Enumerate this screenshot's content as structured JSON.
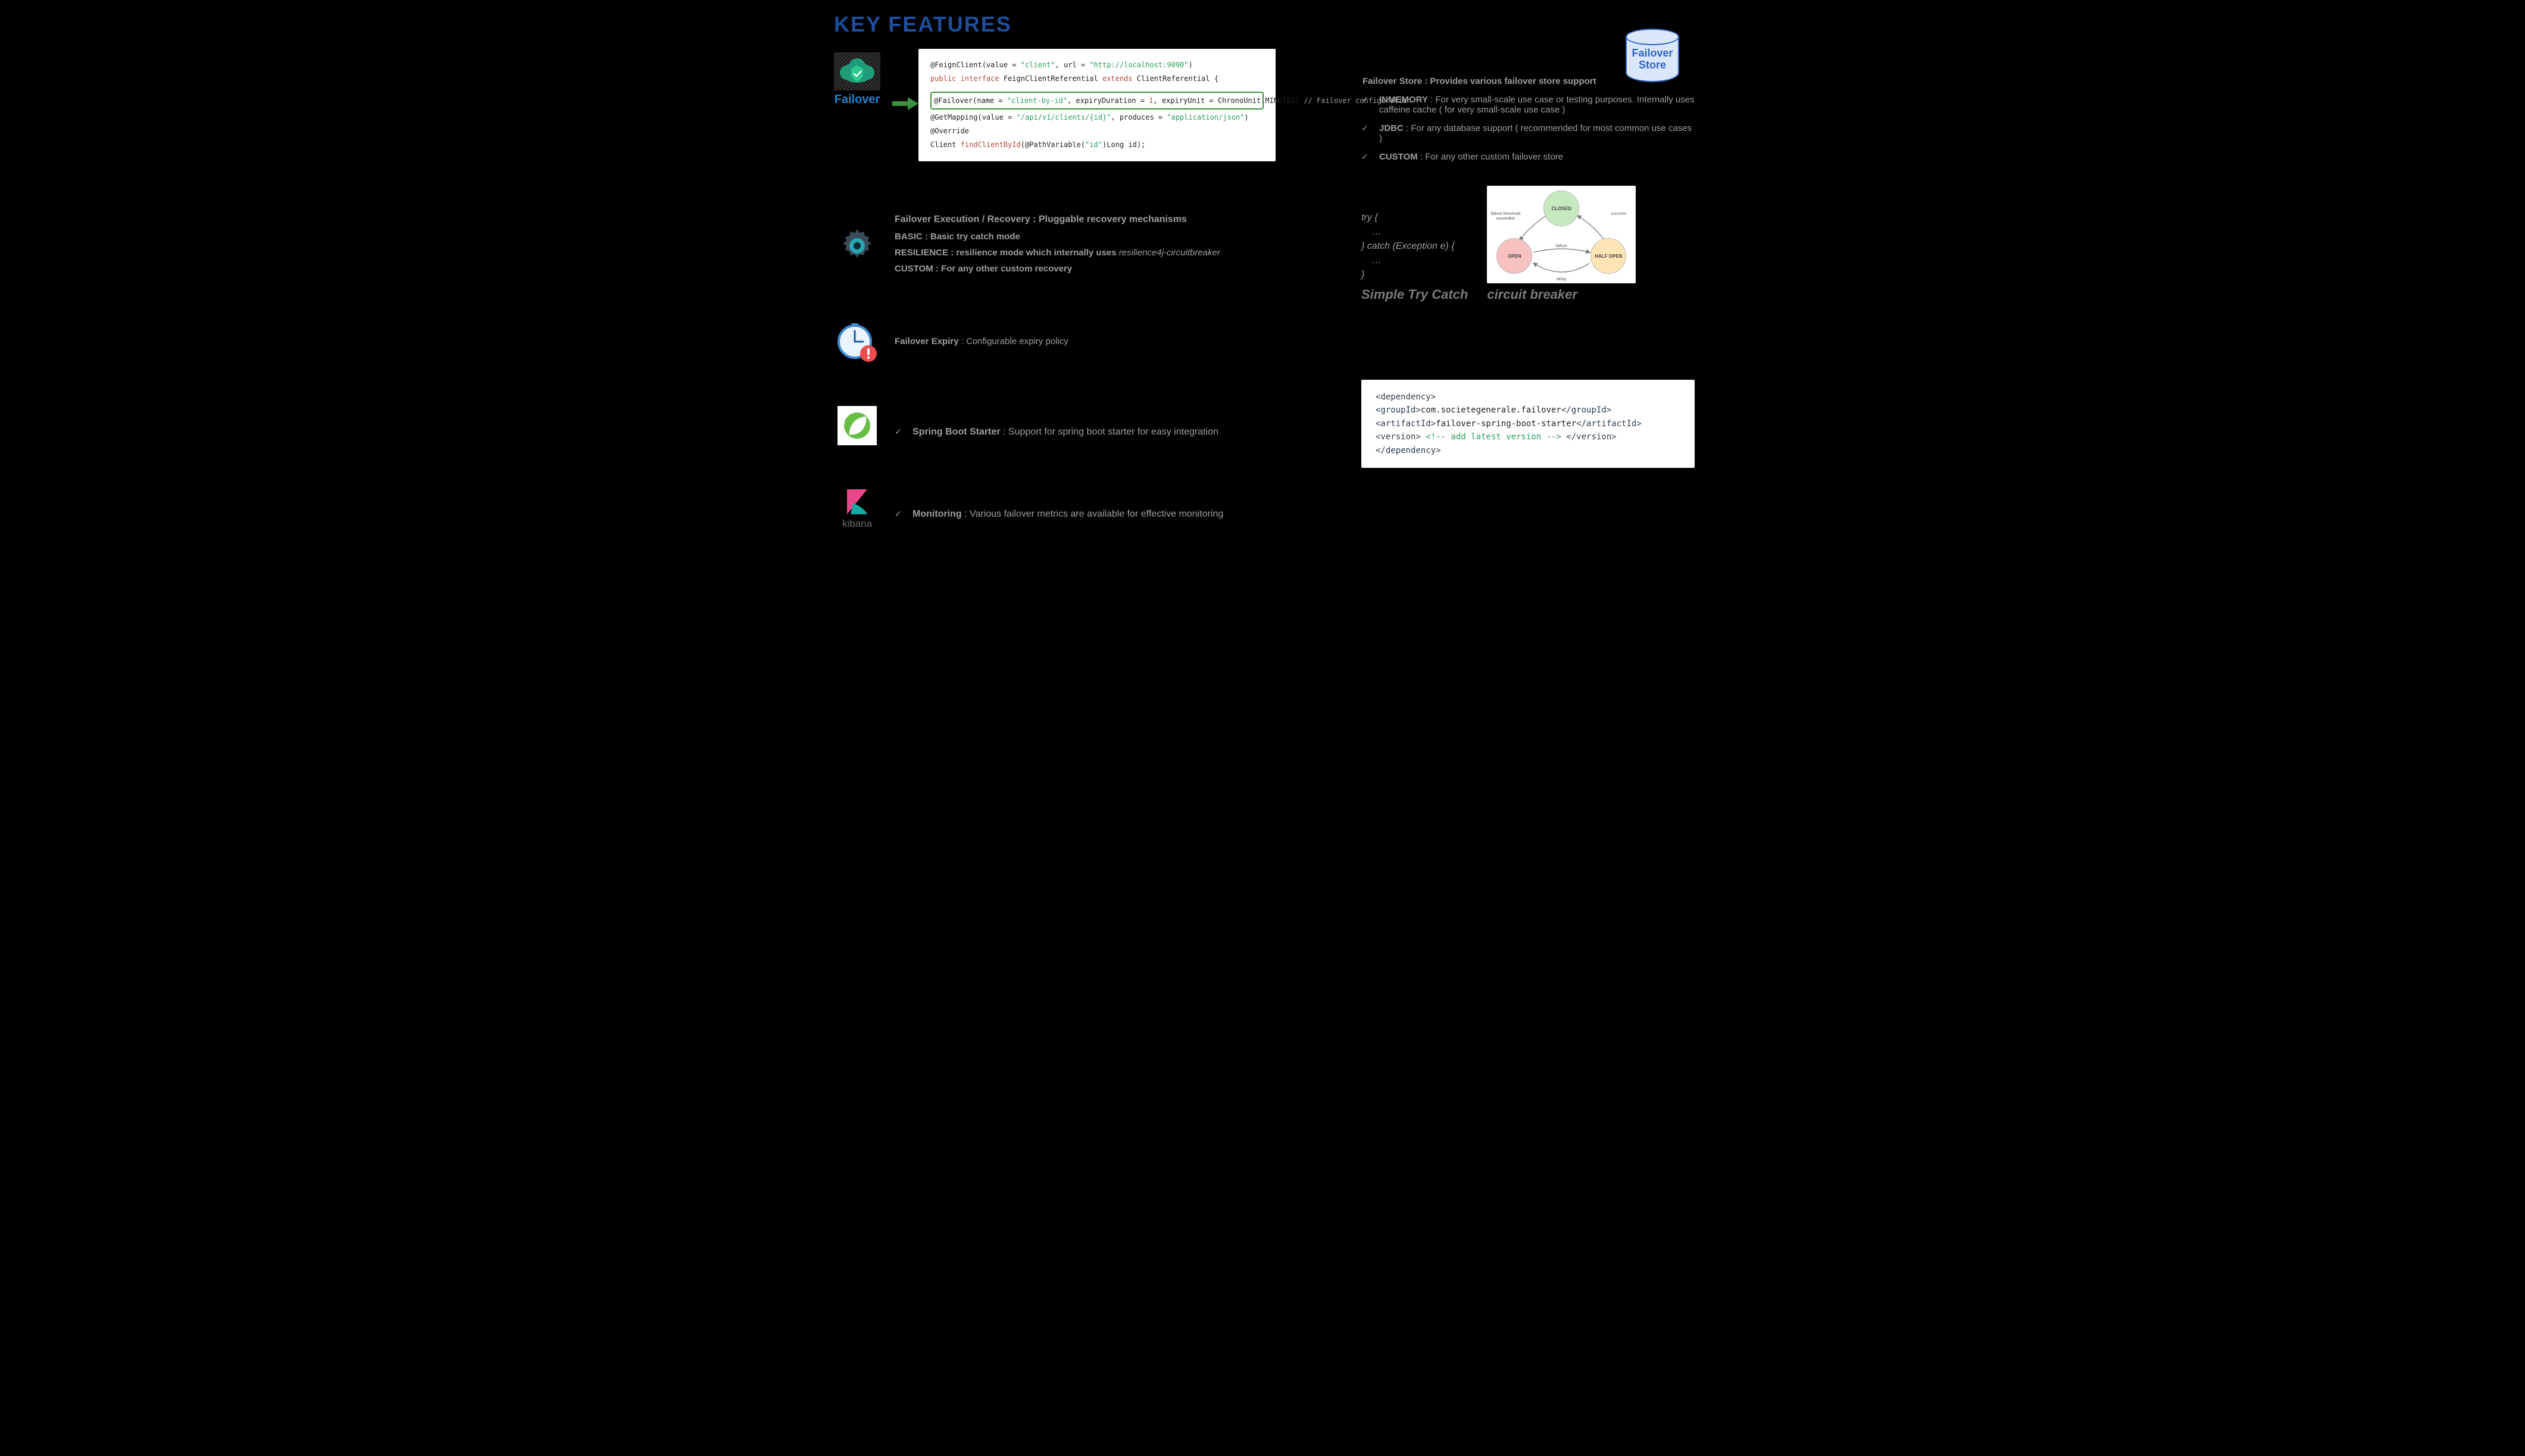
{
  "title": "KEY FEATURES",
  "failover": {
    "caption": "Failover",
    "code": {
      "line1_a": "@FeignClient(value = ",
      "line1_b": "\"client\"",
      "line1_c": ", url = ",
      "line1_d": "\"http://localhost:9090\"",
      "line1_e": ")",
      "line2_a": "public interface",
      "line2_b": " FeignClientReferential ",
      "line2_c": "extends",
      "line2_d": " ClientReferential {",
      "hl_a": "@Failover(name = ",
      "hl_b": "\"client-by-id\"",
      "hl_c": ", expiryDuration = ",
      "hl_d": "1",
      "hl_e": ", expiryUnit = ChronoUnit.MINUTES)",
      "hl_comment": "   // Failover configuration",
      "line4_a": "@GetMapping(value = ",
      "line4_b": "\"/api/v1/clients/{id}\"",
      "line4_c": ", produces = ",
      "line4_d": "\"application/json\"",
      "line4_e": ")",
      "line5": "@Override",
      "line6_a": "Client ",
      "line6_b": "findClientById",
      "line6_c": "(@PathVariable(",
      "line6_d": "\"id\"",
      "line6_e": ")Long id);"
    }
  },
  "store": {
    "cylinder_label": "Failover Store",
    "heading": "Failover Store : Provides various failover store support",
    "bullets": [
      {
        "k": "INMEMORY",
        "v": " : For very small-scale use case or testing purposes. Internally uses caffeine cache ( for very small-scale use case )"
      },
      {
        "k": "JDBC",
        "v": " : For any database support ( recommended for most common use cases )"
      },
      {
        "k": "CUSTOM",
        "v": " : For any other custom failover store"
      }
    ]
  },
  "recovery": {
    "heading": "Failover Execution / Recovery : Pluggable recovery mechanisms",
    "line_a": "BASIC : Basic try catch mode ",
    "line_b": "RESILIENCE : resilience mode which internally uses ",
    "line_em": "resilience4j-circuitbreaker",
    "line_c": "CUSTOM : For any other custom recovery",
    "try_catch": "try {\n    …\n} catch (Exception e) {\n    …\n}",
    "caption_left": "Simple Try Catch",
    "caption_right": "circuit breaker",
    "cb_states": {
      "closed": "CLOSED",
      "open": "OPEN",
      "half": "HALF OPEN"
    },
    "cb_labels": {
      "thresh": "failure threshold exceeded",
      "success": "success",
      "failure": "failure",
      "delay": "delay"
    }
  },
  "expiry": {
    "heading": "Failover Expiry",
    "text": " : Configurable expiry policy"
  },
  "spring": {
    "strong": "Spring Boot Starter",
    "text": " : Support for spring boot starter for easy integration",
    "dep": {
      "l1": "<dependency>",
      "l2a": "    <groupId>",
      "l2b": "com.societegenerale.failover",
      "l2c": "</groupId>",
      "l3a": "    <artifactId>",
      "l3b": "failover-spring-boot-starter",
      "l3c": "</artifactId>",
      "l4a": "    <version>",
      "l4b": " <!-- add latest version --> ",
      "l4c": "</version>",
      "l5": "</dependency>"
    }
  },
  "monitoring": {
    "strong": "Monitoring",
    "text": " : Various failover metrics are available for effective monitoring",
    "kibana_label": "kibana"
  }
}
